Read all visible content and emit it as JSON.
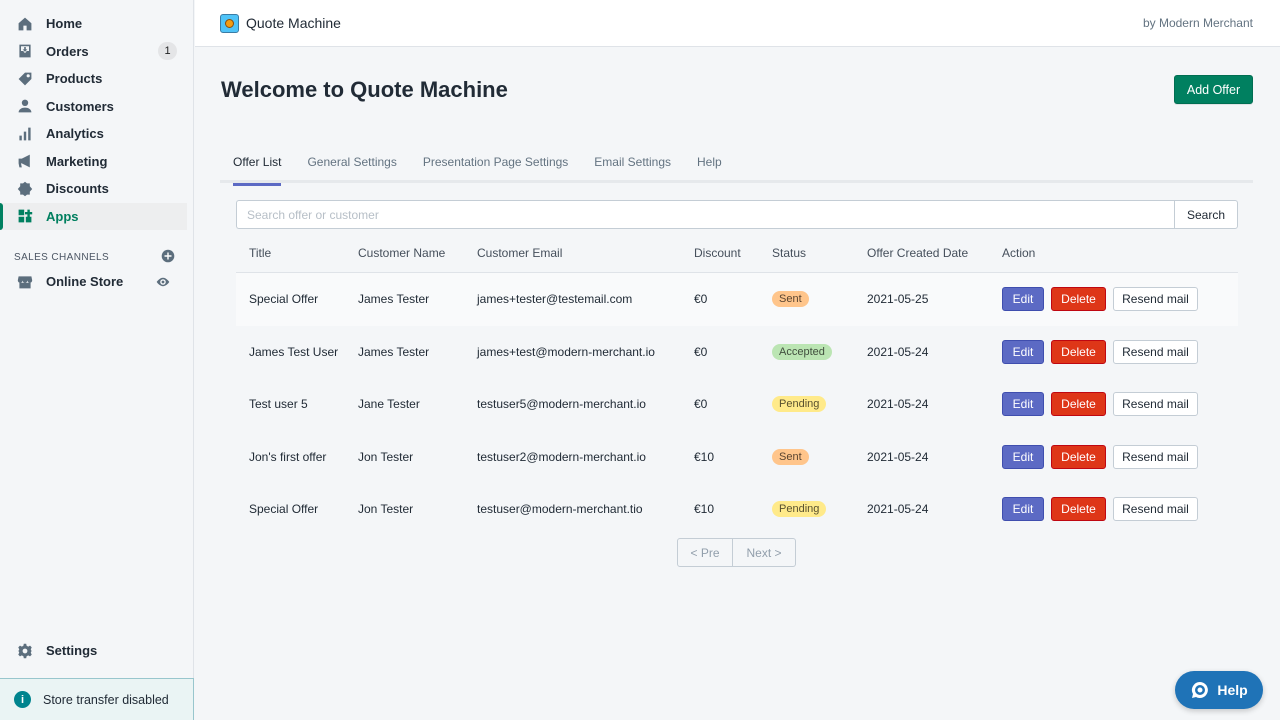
{
  "sidebar": {
    "items": [
      {
        "label": "Home",
        "icon": "home-icon"
      },
      {
        "label": "Orders",
        "icon": "orders-icon",
        "badge": "1"
      },
      {
        "label": "Products",
        "icon": "tag-icon"
      },
      {
        "label": "Customers",
        "icon": "person-icon"
      },
      {
        "label": "Analytics",
        "icon": "bar-chart-icon"
      },
      {
        "label": "Marketing",
        "icon": "megaphone-icon"
      },
      {
        "label": "Discounts",
        "icon": "discount-icon"
      },
      {
        "label": "Apps",
        "icon": "apps-icon",
        "active": true
      }
    ],
    "sales_channels_label": "SALES CHANNELS",
    "online_store": "Online Store",
    "settings": "Settings",
    "store_transfer": "Store transfer disabled"
  },
  "topbar": {
    "app_name": "Quote Machine",
    "by_line": "by Modern Merchant"
  },
  "page": {
    "title": "Welcome to Quote Machine",
    "add_offer": "Add Offer"
  },
  "tabs": [
    "Offer List",
    "General Settings",
    "Presentation Page Settings",
    "Email Settings",
    "Help"
  ],
  "search": {
    "placeholder": "Search offer or customer",
    "button": "Search"
  },
  "table": {
    "headers": [
      "Title",
      "Customer Name",
      "Customer Email",
      "Discount",
      "Status",
      "Offer Created Date",
      "Action"
    ],
    "rows": [
      {
        "title": "Special Offer",
        "customer": "James Tester",
        "email": "james+tester@testemail.com",
        "discount": "€0",
        "status": "Sent",
        "date": "2021-05-25"
      },
      {
        "title": "James Test User",
        "customer": "James Tester",
        "email": "james+test@modern-merchant.io",
        "discount": "€0",
        "status": "Accepted",
        "date": "2021-05-24"
      },
      {
        "title": "Test user 5",
        "customer": "Jane Tester",
        "email": "testuser5@modern-merchant.io",
        "discount": "€0",
        "status": "Pending",
        "date": "2021-05-24"
      },
      {
        "title": "Jon's first offer",
        "customer": "Jon Tester",
        "email": "testuser2@modern-merchant.io",
        "discount": "€10",
        "status": "Sent",
        "date": "2021-05-24"
      },
      {
        "title": "Special Offer",
        "customer": "Jon Tester",
        "email": "testuser@modern-merchant.tio",
        "discount": "€10",
        "status": "Pending",
        "date": "2021-05-24"
      }
    ],
    "actions": {
      "edit": "Edit",
      "delete": "Delete",
      "resend": "Resend mail"
    }
  },
  "pager": {
    "prev": "< Pre",
    "next": "Next >"
  },
  "help_widget": "Help",
  "colors": {
    "accent": "#008060",
    "edit": "#5c6ac4",
    "delete": "#de3618",
    "tab_indicator": "#5c6ac4",
    "help": "#1f73b7"
  }
}
